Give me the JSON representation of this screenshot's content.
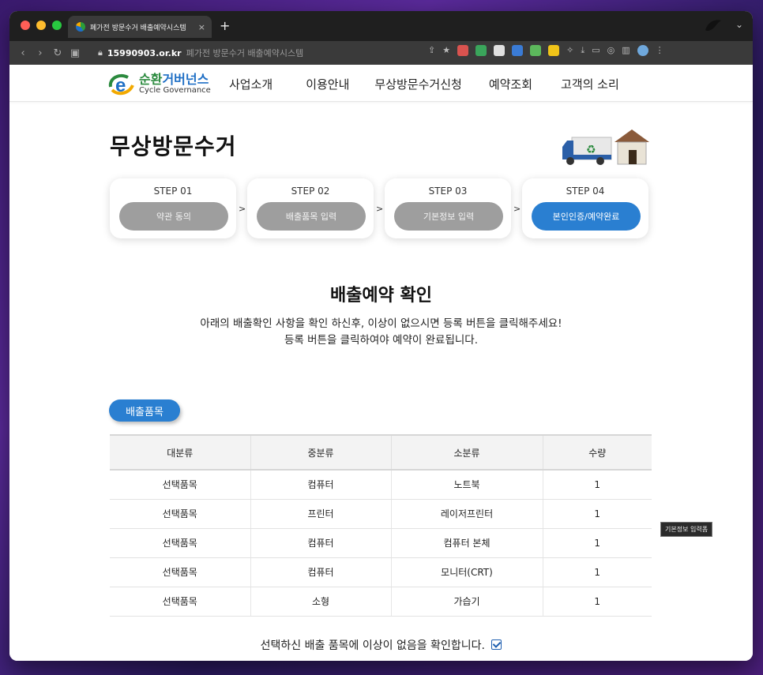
{
  "browser": {
    "tab_title": "폐가전 방문수거 배출예약시스템",
    "tab_close": "×",
    "new_tab": "+",
    "url_host": "15990903.or.kr",
    "url_page_title": "폐가전 방문수거 배출예약시스템",
    "menu_icon": "⌄"
  },
  "site": {
    "logo_korean_prefix": "순환",
    "logo_korean_suffix": "거버넌스",
    "logo_english": "Cycle Governance",
    "nav": [
      "사업소개",
      "이용안내",
      "무상방문수거신청",
      "예약조회",
      "고객의 소리"
    ]
  },
  "page": {
    "title": "무상방문수거",
    "steps": [
      {
        "label": "STEP 01",
        "button": "약관 동의",
        "active": false
      },
      {
        "label": "STEP 02",
        "button": "배출품목 입력",
        "active": false
      },
      {
        "label": "STEP 03",
        "button": "기본정보 입력",
        "active": false
      },
      {
        "label": "STEP 04",
        "button": "본인인증/예약완료",
        "active": true
      }
    ],
    "step_arrow": ">",
    "confirm_title": "배출예약 확인",
    "desc_line1": "아래의 배출확인 사항을 확인 하신후, 이상이 없으시면 등록 버튼을 클릭해주세요!",
    "desc_line2": "등록 버튼을 클릭하여야 예약이 완료됩니다.",
    "section_label": "배출품목",
    "table": {
      "headers": [
        "대분류",
        "중분류",
        "소분류",
        "수량"
      ],
      "rows": [
        [
          "선택품목",
          "컴퓨터",
          "노트북",
          "1"
        ],
        [
          "선택품목",
          "프린터",
          "레이저프린터",
          "1"
        ],
        [
          "선택품목",
          "컴퓨터",
          "컴퓨터 본체",
          "1"
        ],
        [
          "선택품목",
          "컴퓨터",
          "모니터(CRT)",
          "1"
        ],
        [
          "선택품목",
          "소형",
          "가습기",
          "1"
        ]
      ]
    },
    "tooltip": "기본정보 입력폼",
    "agree_text": "선택하신 배출 품목에 이상이 없음을 확인합니다.",
    "agree_checked": true
  },
  "colors": {
    "accent": "#2a7fd1",
    "inactive_pill": "#9e9e9e",
    "logo_green": "#2b8a3e"
  }
}
